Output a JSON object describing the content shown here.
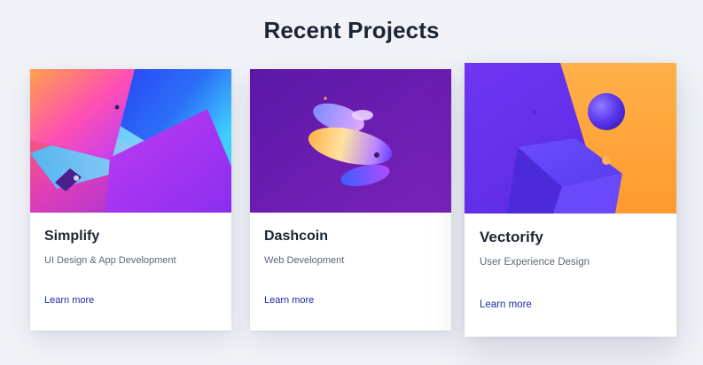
{
  "section": {
    "title": "Recent Projects"
  },
  "projects": [
    {
      "name": "Simplify",
      "category": "UI Design & App Development",
      "link_label": "Learn more",
      "art": "abstract-gradient-shapes"
    },
    {
      "name": "Dashcoin",
      "category": "Web Development",
      "link_label": "Learn more",
      "art": "stacked-discs"
    },
    {
      "name": "Vectorify",
      "category": "User Experience Design",
      "link_label": "Learn more",
      "art": "cube-and-sphere"
    }
  ],
  "colors": {
    "background": "#f1f3f8",
    "heading": "#1c2534",
    "link": "#1a2ea6",
    "purple": "#6a2fe0",
    "orange": "#ffa53a"
  }
}
